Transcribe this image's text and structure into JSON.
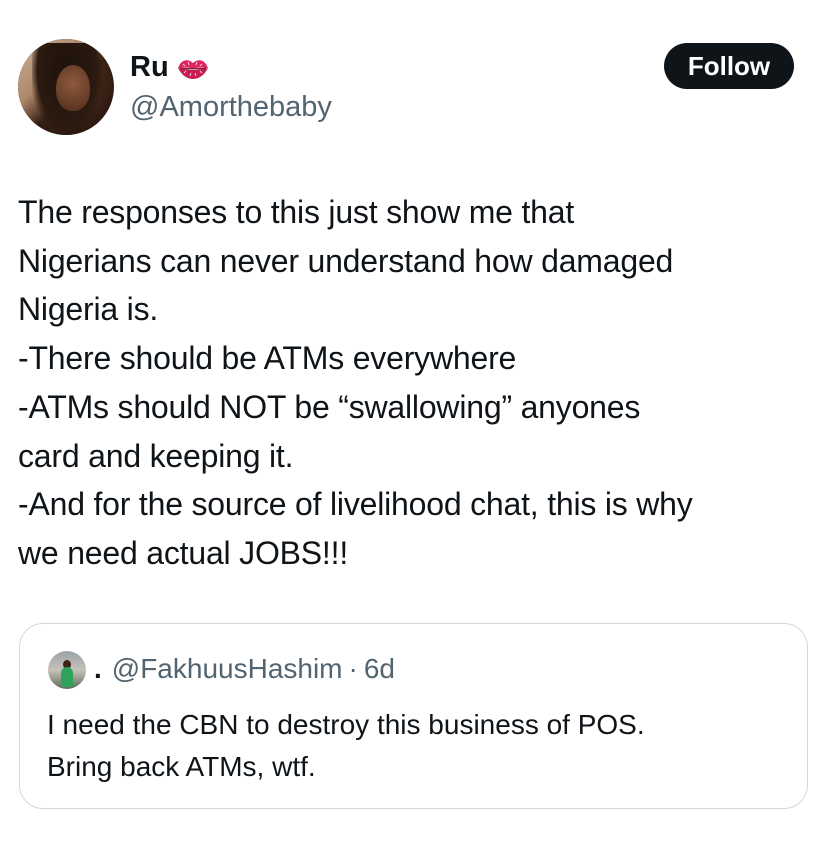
{
  "author": {
    "display_name": "Ru",
    "name_emoji_icon": "kiss-mark-icon",
    "handle": "@Amorthebaby"
  },
  "follow_button": {
    "label": "Follow"
  },
  "tweet": {
    "text": "The responses to this just show me that\nNigerians can never understand how damaged\nNigeria is.\n-There should be ATMs everywhere\n-ATMs should NOT be “swallowing” anyones\ncard and keeping it.\n-And for the source of livelihood chat, this is why\nwe need actual JOBS!!!"
  },
  "quoted_tweet": {
    "display_name": ".",
    "handle": "@FakhuusHashim",
    "separator": "·",
    "time": "6d",
    "text": "I need the CBN to destroy this business of POS.\nBring back ATMs, wtf."
  },
  "colors": {
    "text_primary": "#0f1419",
    "text_secondary": "#536471",
    "follow_bg": "#0f1419",
    "card_border": "#cfd9de",
    "kiss_red": "#e0245e"
  }
}
